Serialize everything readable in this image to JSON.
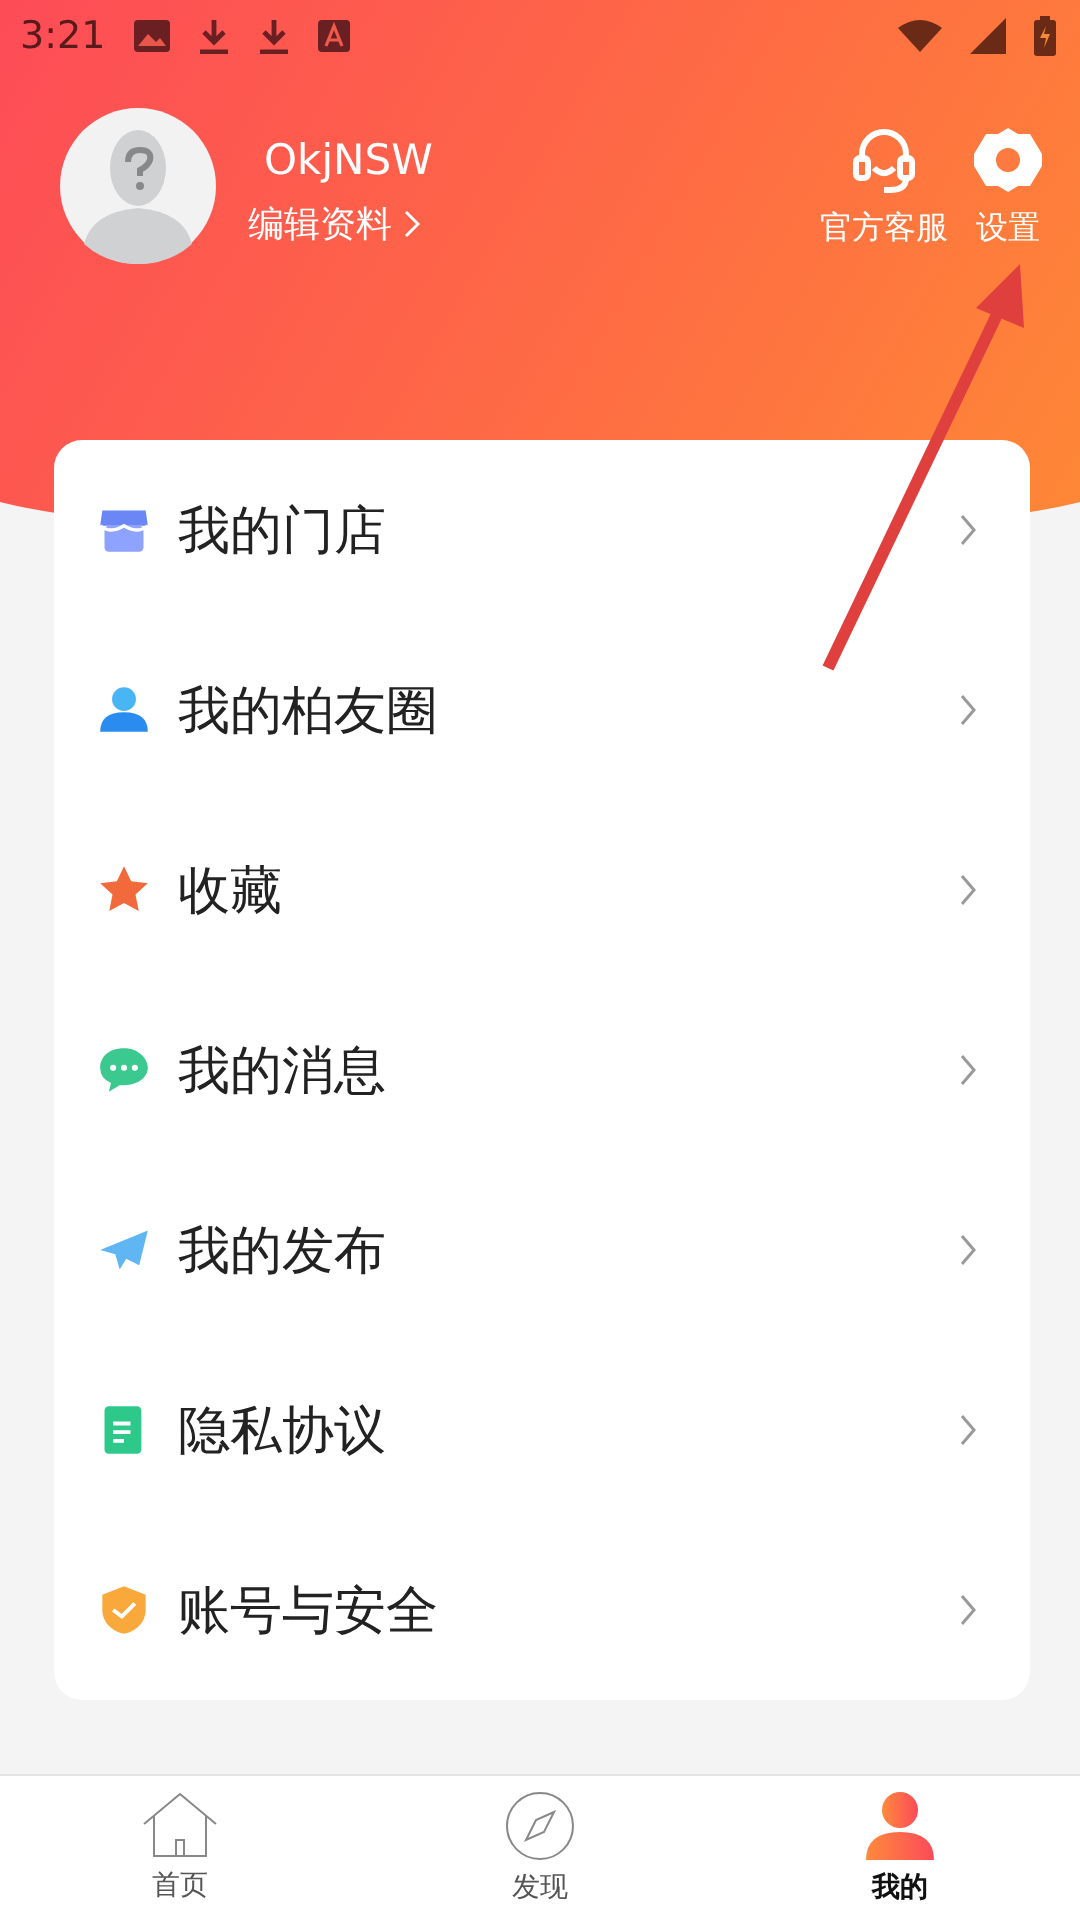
{
  "status_bar": {
    "time": "3:21"
  },
  "profile": {
    "username": "OkjNSW",
    "edit_link": "编辑资料"
  },
  "header_actions": [
    {
      "kind": "support",
      "label": "官方客服"
    },
    {
      "kind": "settings",
      "label": "设置"
    }
  ],
  "menu": [
    {
      "kind": "store",
      "label": "我的门店"
    },
    {
      "kind": "person",
      "label": "我的柏友圈"
    },
    {
      "kind": "star",
      "label": "收藏"
    },
    {
      "kind": "chat",
      "label": "我的消息"
    },
    {
      "kind": "plane",
      "label": "我的发布"
    },
    {
      "kind": "doc",
      "label": "隐私协议"
    },
    {
      "kind": "shield",
      "label": "账号与安全"
    }
  ],
  "tabs": [
    {
      "kind": "home",
      "label": "首页",
      "selected": false
    },
    {
      "kind": "compass",
      "label": "发现",
      "selected": false
    },
    {
      "kind": "person",
      "label": "我的",
      "selected": true
    }
  ]
}
